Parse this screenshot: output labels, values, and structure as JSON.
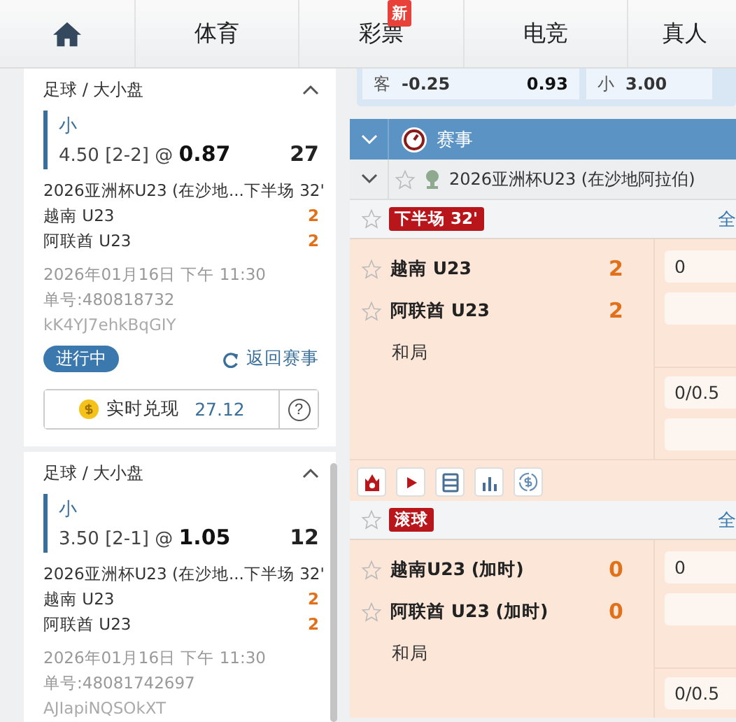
{
  "nav": {
    "items": [
      {
        "kind": "home",
        "selected": false
      },
      {
        "kind": "text",
        "label": "体育",
        "selected": false
      },
      {
        "kind": "text",
        "label": "彩票",
        "badge": "新",
        "selected": false
      },
      {
        "kind": "text",
        "label": "电竞",
        "selected": false
      },
      {
        "kind": "text",
        "label": "真人",
        "selected": false
      }
    ]
  },
  "bets": [
    {
      "market": "足球 / 大小盘",
      "expanded": true,
      "pick": "小",
      "line": "4.50 [2-2] @ ",
      "odds": "0.87",
      "stake": "27",
      "league": "2026亚洲杯U23 (在沙地...",
      "period": "下半场 32'",
      "teams": [
        {
          "name": "越南 U23",
          "score": "2"
        },
        {
          "name": "阿联酋 U23",
          "score": "2"
        }
      ],
      "date": "2026年01月16日 下午 11:30",
      "ticket": "单号:480818732",
      "code": "kK4YJ7ehkBqGIY",
      "status": "进行中",
      "back": "返回赛事",
      "cashout_label": "实时兑现",
      "cashout_value": "27.12",
      "help": "?"
    },
    {
      "market": "足球 / 大小盘",
      "expanded": true,
      "pick": "小",
      "line": "3.50 [2-1] @ ",
      "odds": "1.05",
      "stake": "12",
      "league": "2026亚洲杯U23 (在沙地...",
      "period": "下半场 32'",
      "teams": [
        {
          "name": "越南 U23",
          "score": "2"
        },
        {
          "name": "阿联酋 U23",
          "score": "2"
        }
      ],
      "date": "2026年01月16日 下午 11:30",
      "ticket": "单号:48081742697",
      "code": "AJIapiNQSOkXT"
    }
  ],
  "top_odds": [
    {
      "label": "客",
      "handicap": "-0.25",
      "odds": "0.93"
    },
    {
      "label": "小",
      "handicap": "3.00"
    }
  ],
  "section": {
    "title": "赛事",
    "expanded": true
  },
  "league": {
    "name": "2026亚洲杯U23 (在沙地阿拉伯)",
    "expanded": true,
    "favorite": false
  },
  "matches": [
    {
      "status": "下半场 32'",
      "market_link": "全",
      "teams": [
        {
          "name": "越南 U23",
          "score": "2",
          "favorite": false
        },
        {
          "name": "阿联酋 U23",
          "score": "2",
          "favorite": false
        }
      ],
      "draw": "和局",
      "odds_1": [
        {
          "kind": "price",
          "value": "0"
        },
        {
          "kind": "blank"
        }
      ],
      "odds_2": [
        {
          "kind": "price",
          "value": "0/0.5"
        },
        {
          "kind": "blank"
        }
      ],
      "tools": [
        {
          "kind": "stream"
        },
        {
          "kind": "play"
        },
        {
          "kind": "list"
        },
        {
          "kind": "stats"
        },
        {
          "kind": "cash"
        }
      ]
    },
    {
      "status": "滚球",
      "market_link": "全",
      "teams": [
        {
          "name": "越南U23 (加时)",
          "score": "0",
          "favorite": false
        },
        {
          "name": "阿联酋 U23 (加时)",
          "score": "0",
          "favorite": false
        }
      ],
      "draw": "和局",
      "odds_1": [
        {
          "kind": "price",
          "value": "0"
        },
        {
          "kind": "blank"
        }
      ],
      "odds_2": [
        {
          "kind": "price",
          "value": "0/0.5"
        }
      ]
    }
  ]
}
